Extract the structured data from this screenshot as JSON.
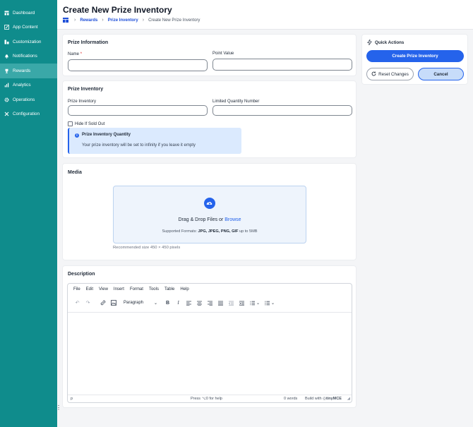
{
  "sidebar": {
    "items": [
      {
        "label": "Dashboard",
        "icon": "dashboard-icon"
      },
      {
        "label": "App Content",
        "icon": "edit-icon"
      },
      {
        "label": "Customization",
        "icon": "customize-icon"
      },
      {
        "label": "Notifications",
        "icon": "bell-icon"
      },
      {
        "label": "Rewards",
        "icon": "trophy-icon",
        "active": true
      },
      {
        "label": "Analytics",
        "icon": "bar-chart-icon"
      },
      {
        "label": "Operations",
        "icon": "gear-icon"
      },
      {
        "label": "Configuration",
        "icon": "tools-icon"
      }
    ]
  },
  "header": {
    "title": "Create New Prize Inventory",
    "breadcrumb": [
      "Rewards",
      "Prize Inventory",
      "Create New Prize Inventory"
    ]
  },
  "prize_information": {
    "title": "Prize Information",
    "name_label": "Name",
    "name_required": "*",
    "name_value": "",
    "point_value_label": "Point Value",
    "point_value_value": ""
  },
  "prize_inventory": {
    "title": "Prize Inventory",
    "inventory_label": "Prize Inventory",
    "inventory_value": "",
    "limited_label": "Limited Quantity Number",
    "limited_value": "",
    "hide_sold_out_label": "Hide If Sold Out",
    "hide_sold_out_checked": false,
    "info_title": "Prize Inventory Quantity",
    "info_text": "Your prize inventory will be set to infinity if you leave it empty"
  },
  "media": {
    "title": "Media",
    "drop_text": "Drag & Drop Files or",
    "browse_link": "Browse",
    "formats_prefix": "Supported Formats:",
    "formats_list": "JPG, JPEG, PNG, GIF",
    "formats_suffix": "up to 5MB",
    "recommended": "Recommended size 450 × 450 pixels"
  },
  "description": {
    "title": "Description",
    "menu": [
      "File",
      "Edit",
      "View",
      "Insert",
      "Format",
      "Tools",
      "Table",
      "Help"
    ],
    "block_format": "Paragraph",
    "status_path": "p",
    "status_help": "Press ⌥0 for help",
    "word_count": "0 words",
    "built_with": "Build with",
    "brand": "tinyMCE"
  },
  "quick_actions": {
    "title": "Quick Actions",
    "create_label": "Create Prize Inventory",
    "reset_label": "Reset Changes",
    "cancel_label": "Cancel"
  },
  "colors": {
    "sidebar": "#0f8c8c",
    "primary": "#2563eb",
    "link": "#1d4ed8"
  }
}
